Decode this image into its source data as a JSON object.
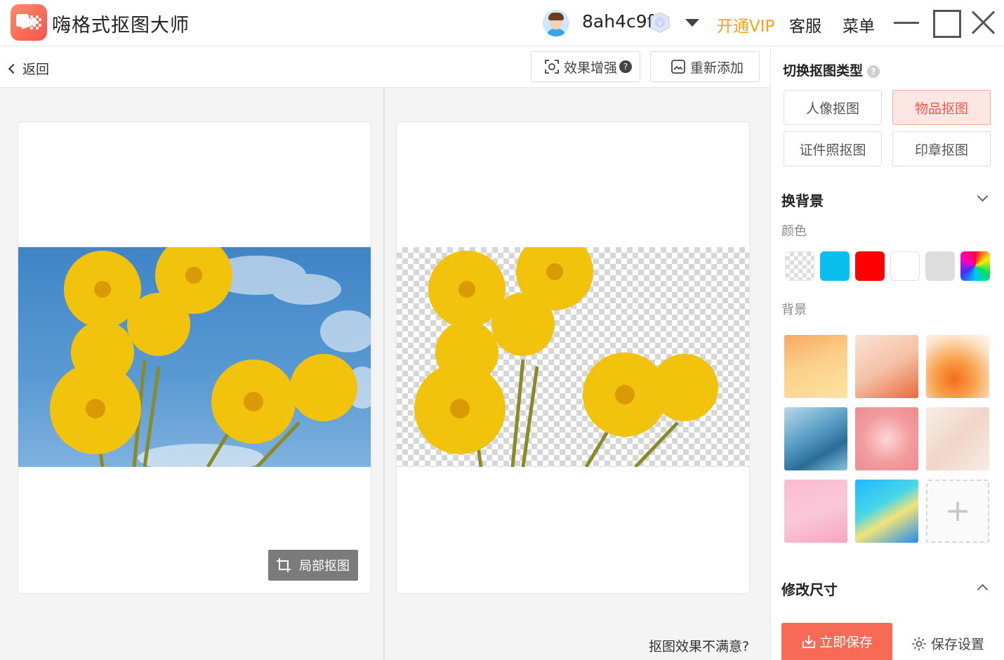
{
  "app": {
    "title": "嗨格式抠图大师",
    "username": "8ah4c9f",
    "vip_label": "开通VIP",
    "service_label": "客服",
    "menu_label": "菜单",
    "accent_color": "#f76a55",
    "vip_color": "#f7a21a"
  },
  "toolbar": {
    "back_label": "返回",
    "enhance_label": "效果增强",
    "readd_label": "重新添加"
  },
  "canvas": {
    "crop_label": "局部抠图",
    "unsatisfied_label": "抠图效果不满意?"
  },
  "sidebar": {
    "type_title": "切换抠图类型",
    "types": [
      {
        "label": "人像抠图",
        "active": false
      },
      {
        "label": "物品抠图",
        "active": true
      },
      {
        "label": "证件照抠图",
        "active": false
      },
      {
        "label": "印章抠图",
        "active": false
      }
    ],
    "bg_section_title": "换背景",
    "color_label": "颜色",
    "colors": [
      "transparent",
      "#0abfee",
      "#ff0000",
      "#ffffff",
      "#dddddd",
      "rainbow"
    ],
    "bg_label": "背景",
    "resize_title": "修改尺寸",
    "save_label": "立即保存",
    "save_settings_label": "保存设置"
  }
}
